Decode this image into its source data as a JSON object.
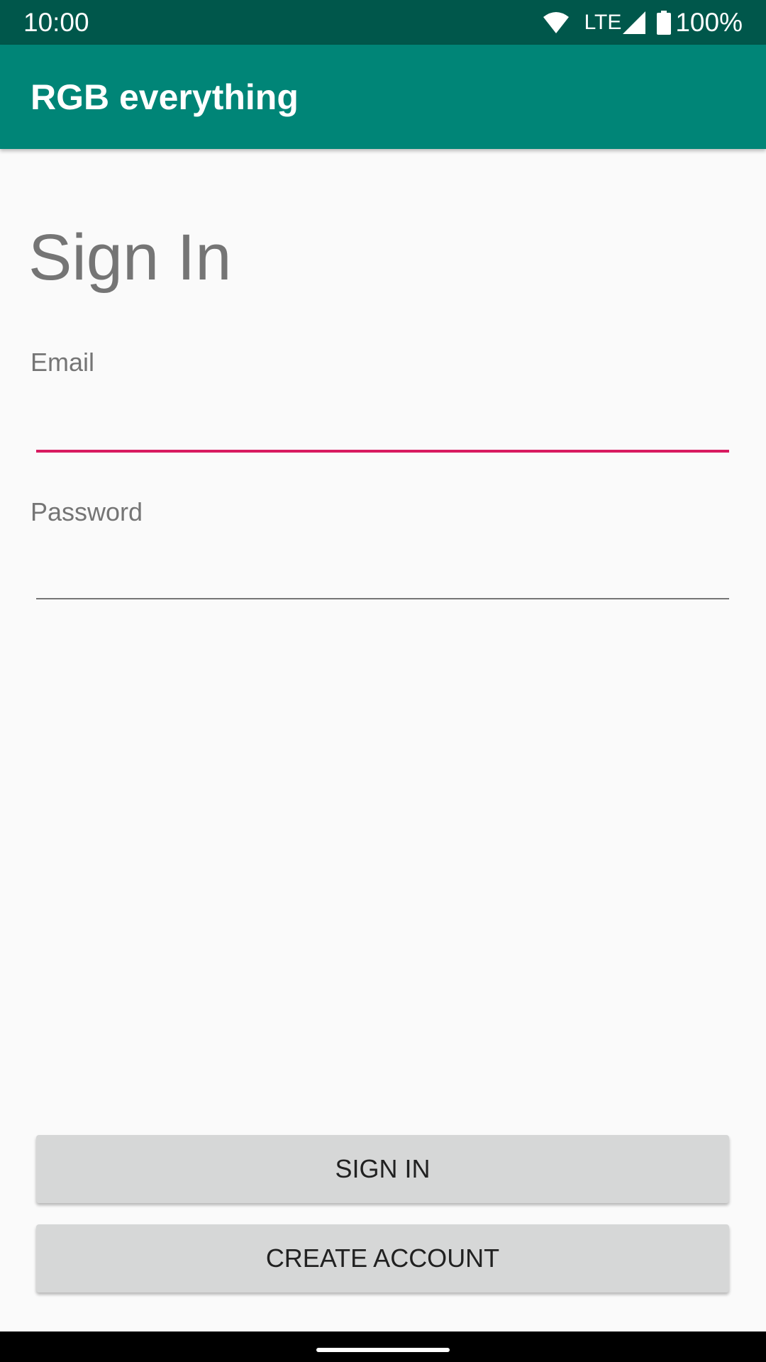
{
  "status_bar": {
    "time": "10:00",
    "network": "LTE",
    "battery": "100%",
    "icons": [
      "wifi-icon",
      "cell-signal-icon",
      "battery-icon"
    ]
  },
  "app_bar": {
    "title": "RGB everything"
  },
  "page": {
    "heading": "Sign In"
  },
  "form": {
    "email": {
      "label": "Email",
      "value": "",
      "state": "focused"
    },
    "password": {
      "label": "Password",
      "value": ""
    }
  },
  "actions": {
    "sign_in": "SIGN IN",
    "create_account": "CREATE ACCOUNT"
  },
  "colors": {
    "status_bar": "#00574B",
    "app_bar": "#008577",
    "accent": "#D81B60",
    "button": "#D6D7D7",
    "background": "#FAFAFA"
  }
}
